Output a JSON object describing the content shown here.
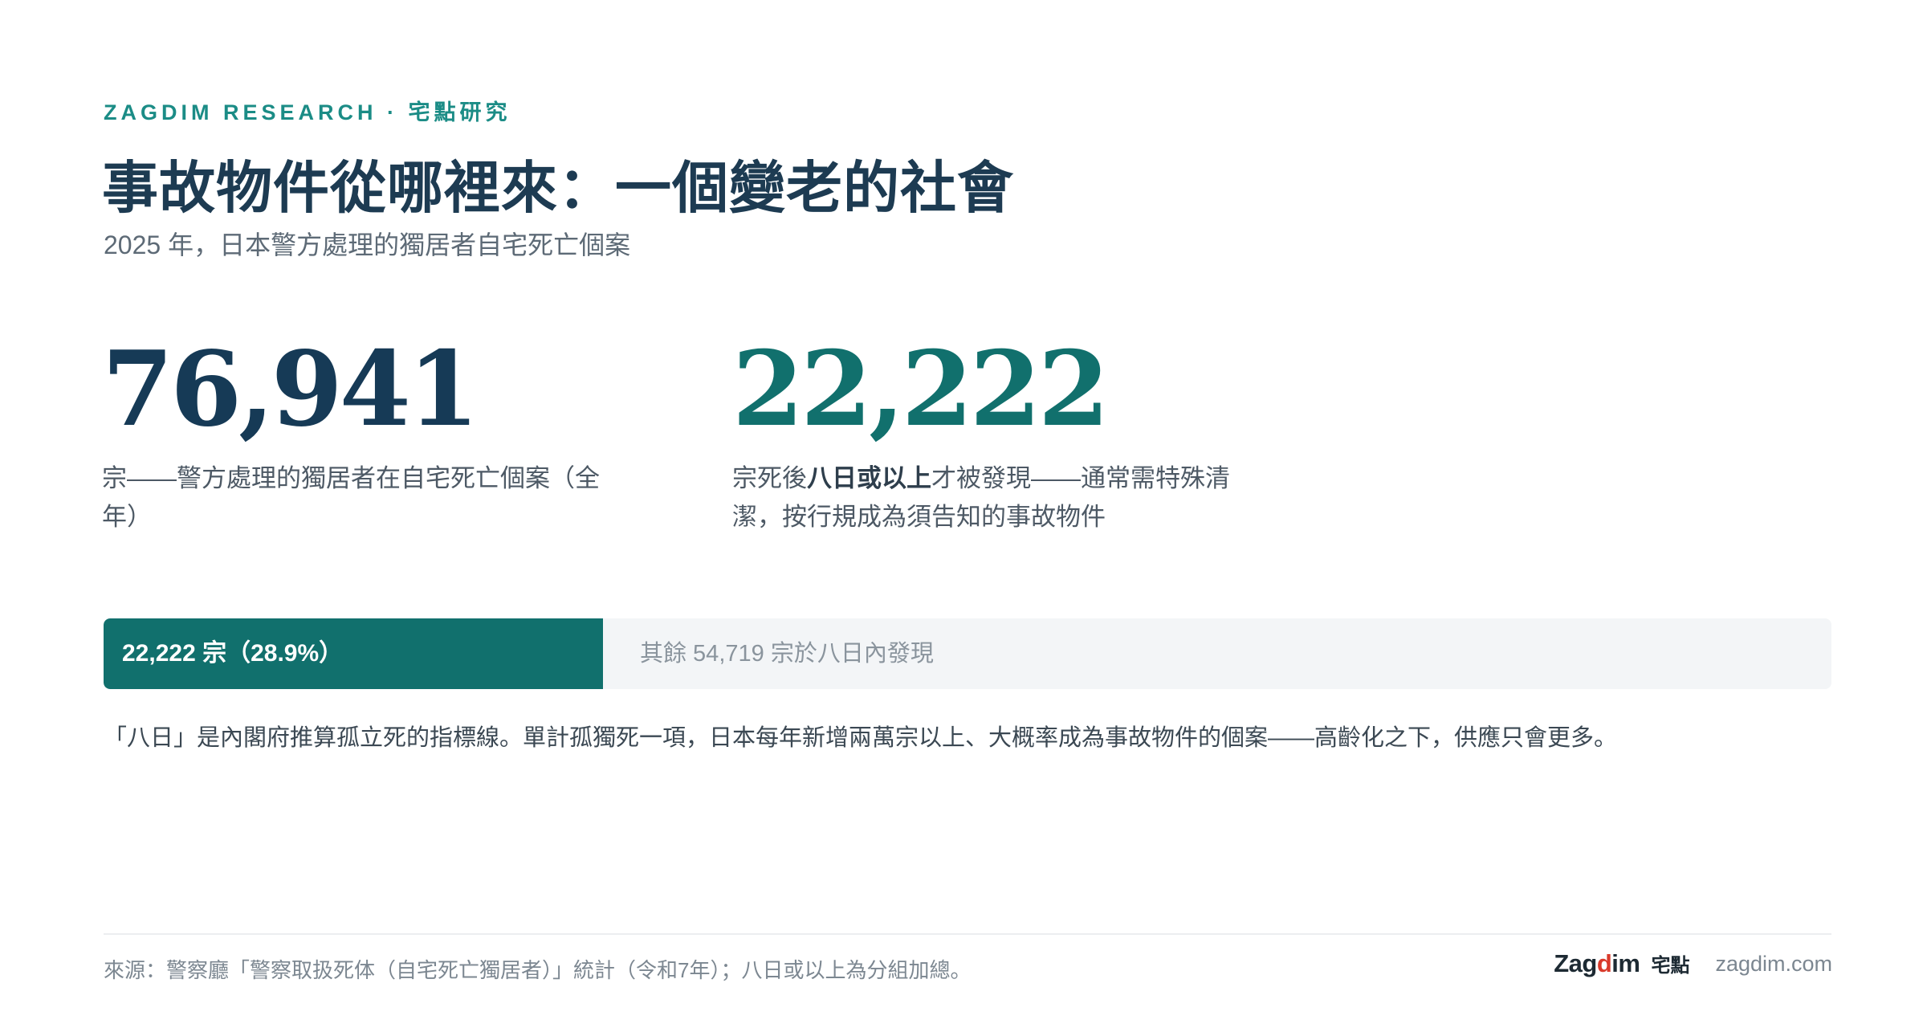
{
  "header": {
    "kicker": "ZAGDIM RESEARCH · 宅點研究",
    "title": "事故物件從哪裡來：一個變老的社會",
    "subtitle": "2025 年，日本警方處理的獨居者自宅死亡個案"
  },
  "stats": {
    "total": {
      "value": "76,941",
      "desc": "宗——警方處理的獨居者在自宅死亡個案（全年）",
      "color": "#163a56"
    },
    "late": {
      "value": "22,222",
      "desc_before": "宗死後",
      "desc_bold": "八日或以上",
      "desc_after": "才被發現——通常需特殊清潔，按行規成為須告知的事故物件",
      "color": "#11706d"
    }
  },
  "bar": {
    "share": 0.289,
    "fill_label": "22,222 宗（28.9%）",
    "rest_label": "其餘 54,719 宗於八日內發現",
    "fill_color": "#11706d",
    "track_color": "#f3f5f7"
  },
  "note": "「八日」是內閣府推算孤立死的指標線。單計孤獨死一項，日本每年新增兩萬宗以上、大概率成為事故物件的個案——高齡化之下，供應只會更多。",
  "footer": {
    "source": "來源：警察廳「警察取扱死体（自宅死亡獨居者）」統計（令和7年）；八日或以上為分組加總。",
    "logo_prefix": "Zag",
    "logo_accent": "d",
    "logo_suffix": "im",
    "logo_cjk": "宅點",
    "site": "zagdim.com",
    "accent_color": "#d93a2b"
  }
}
